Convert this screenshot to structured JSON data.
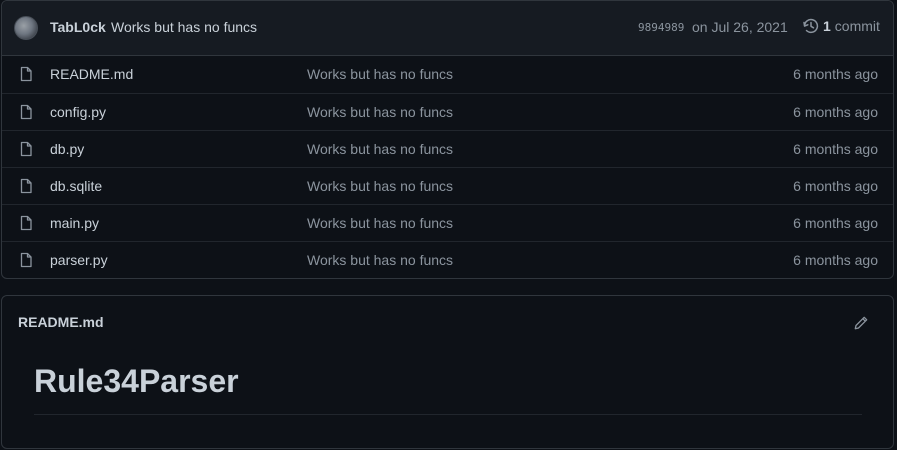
{
  "commit": {
    "author": "TabL0ck",
    "message": "Works but has no funcs",
    "sha": "9894989",
    "date": "on Jul 26, 2021",
    "count": "1",
    "count_label": "commit"
  },
  "files": [
    {
      "name": "README.md",
      "message": "Works but has no funcs",
      "age": "6 months ago",
      "icon": "file-icon"
    },
    {
      "name": "config.py",
      "message": "Works but has no funcs",
      "age": "6 months ago",
      "icon": "file-icon"
    },
    {
      "name": "db.py",
      "message": "Works but has no funcs",
      "age": "6 months ago",
      "icon": "file-icon"
    },
    {
      "name": "db.sqlite",
      "message": "Works but has no funcs",
      "age": "6 months ago",
      "icon": "file-icon"
    },
    {
      "name": "main.py",
      "message": "Works but has no funcs",
      "age": "6 months ago",
      "icon": "file-icon"
    },
    {
      "name": "parser.py",
      "message": "Works but has no funcs",
      "age": "6 months ago",
      "icon": "file-icon"
    }
  ],
  "readme": {
    "filename": "README.md",
    "heading": "Rule34Parser",
    "edit_icon": "pencil-icon"
  },
  "colors": {
    "background": "#0d1117",
    "header_bg": "#161b22",
    "border": "#30363d",
    "text": "#c9d1d9",
    "muted": "#8b949e"
  }
}
